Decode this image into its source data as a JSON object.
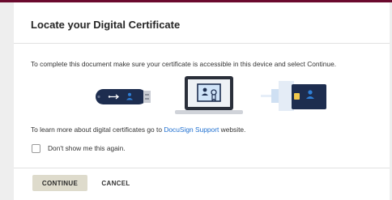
{
  "dialog": {
    "title": "Locate your Digital Certificate",
    "instructions": "To complete this document make sure your certificate is accessible in this device and select Continue.",
    "learn_more_prefix": "To learn more about digital certificates go to ",
    "learn_more_link": "DocuSign Support",
    "learn_more_suffix": " website.",
    "checkbox_label": "Don't show me this again.",
    "checkbox_checked": false
  },
  "buttons": {
    "continue_label": "CONTINUE",
    "cancel_label": "CANCEL"
  },
  "icons": {
    "usb": "usb-token-icon",
    "laptop": "laptop-certificate-icon",
    "smart_card": "smart-card-reader-icon"
  },
  "colors": {
    "accent": "#6b0a2e",
    "link": "#1e6fd0",
    "primary_button": "#dedbcc",
    "device_navy": "#1d2d4f",
    "device_blue": "#2f80d8"
  }
}
